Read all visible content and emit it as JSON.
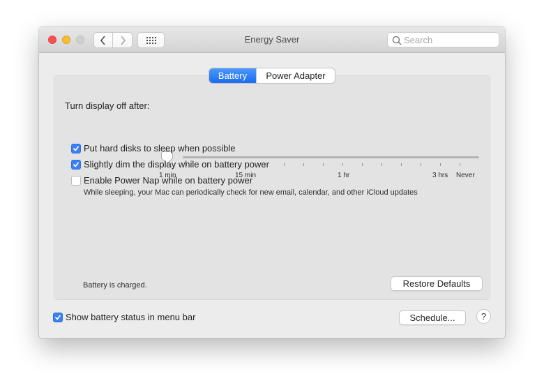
{
  "window": {
    "title": "Energy Saver",
    "search_placeholder": "Search",
    "search_value": ""
  },
  "tabs": [
    {
      "label": "Battery",
      "selected": true
    },
    {
      "label": "Power Adapter",
      "selected": false
    }
  ],
  "display_sleep": {
    "label": "Turn display off after:",
    "tick_count": 16,
    "value": "1 min",
    "value_fraction": 0.0,
    "tick_labels": [
      "1 min",
      "15 min",
      "1 hr",
      "3 hrs",
      "Never"
    ]
  },
  "options": [
    {
      "label": "Put hard disks to sleep when possible",
      "checked": true
    },
    {
      "label": "Slightly dim the display while on battery power",
      "checked": true
    },
    {
      "label": "Enable Power Nap while on battery power",
      "checked": false,
      "description": "While sleeping, your Mac can periodically check for new email, calendar, and other iCloud updates"
    }
  ],
  "status": "Battery is charged.",
  "buttons": {
    "restore": "Restore Defaults",
    "schedule": "Schedule...",
    "help": "?"
  },
  "menu_bar_option": {
    "label": "Show battery status in menu bar",
    "checked": true
  },
  "colors": {
    "accent": "#1a6cf2",
    "close": "#fc4f4f",
    "minimize": "#fdbc2e",
    "zoom_disabled": "#d0d0d0"
  }
}
